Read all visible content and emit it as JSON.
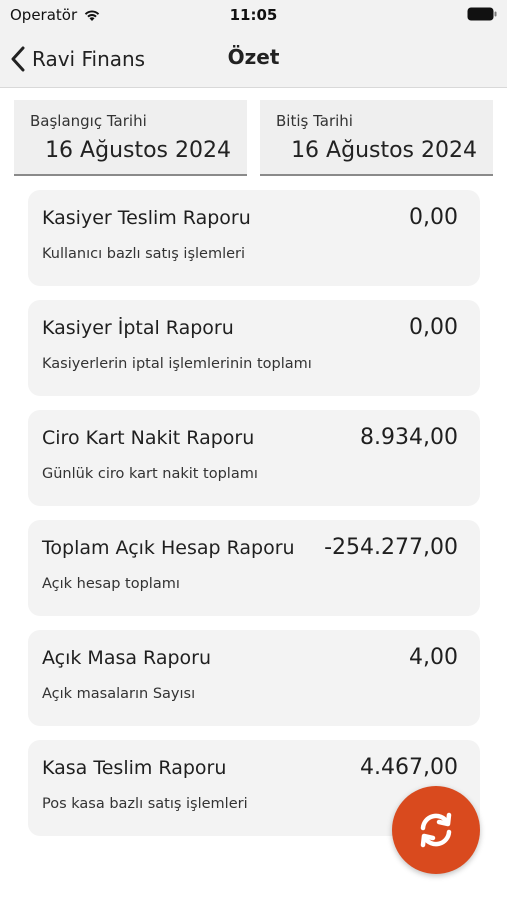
{
  "status_bar": {
    "carrier": "Operatör",
    "time": "11:05",
    "icons": [
      "wifi-icon",
      "battery-icon"
    ]
  },
  "nav": {
    "back_label": "Ravi Finans",
    "title": "Özet",
    "back_icon": "chevron-left-icon"
  },
  "dates": {
    "start_label": "Başlangıç Tarihi",
    "start_value": "16 Ağustos 2024",
    "end_label": "Bitiş Tarihi",
    "end_value": "16 Ağustos 2024"
  },
  "reports": [
    {
      "title": "Kasiyer Teslim Raporu",
      "value": "0,00",
      "subtitle": "Kullanıcı bazlı satış işlemleri"
    },
    {
      "title": "Kasiyer İptal Raporu",
      "value": "0,00",
      "subtitle": "Kasiyerlerin iptal işlemlerinin toplamı"
    },
    {
      "title": "Ciro Kart Nakit Raporu",
      "value": "8.934,00",
      "subtitle": "Günlük ciro kart nakit toplamı"
    },
    {
      "title": "Toplam Açık Hesap Raporu",
      "value": "-254.277,00",
      "subtitle": "Açık hesap toplamı"
    },
    {
      "title": "Açık Masa Raporu",
      "value": "4,00",
      "subtitle": "Açık masaların Sayısı"
    },
    {
      "title": "Kasa Teslim Raporu",
      "value": "4.467,00",
      "subtitle": "Pos kasa bazlı satış işlemleri"
    }
  ],
  "fab": {
    "icon": "refresh-icon",
    "color": "#d94a1e"
  }
}
